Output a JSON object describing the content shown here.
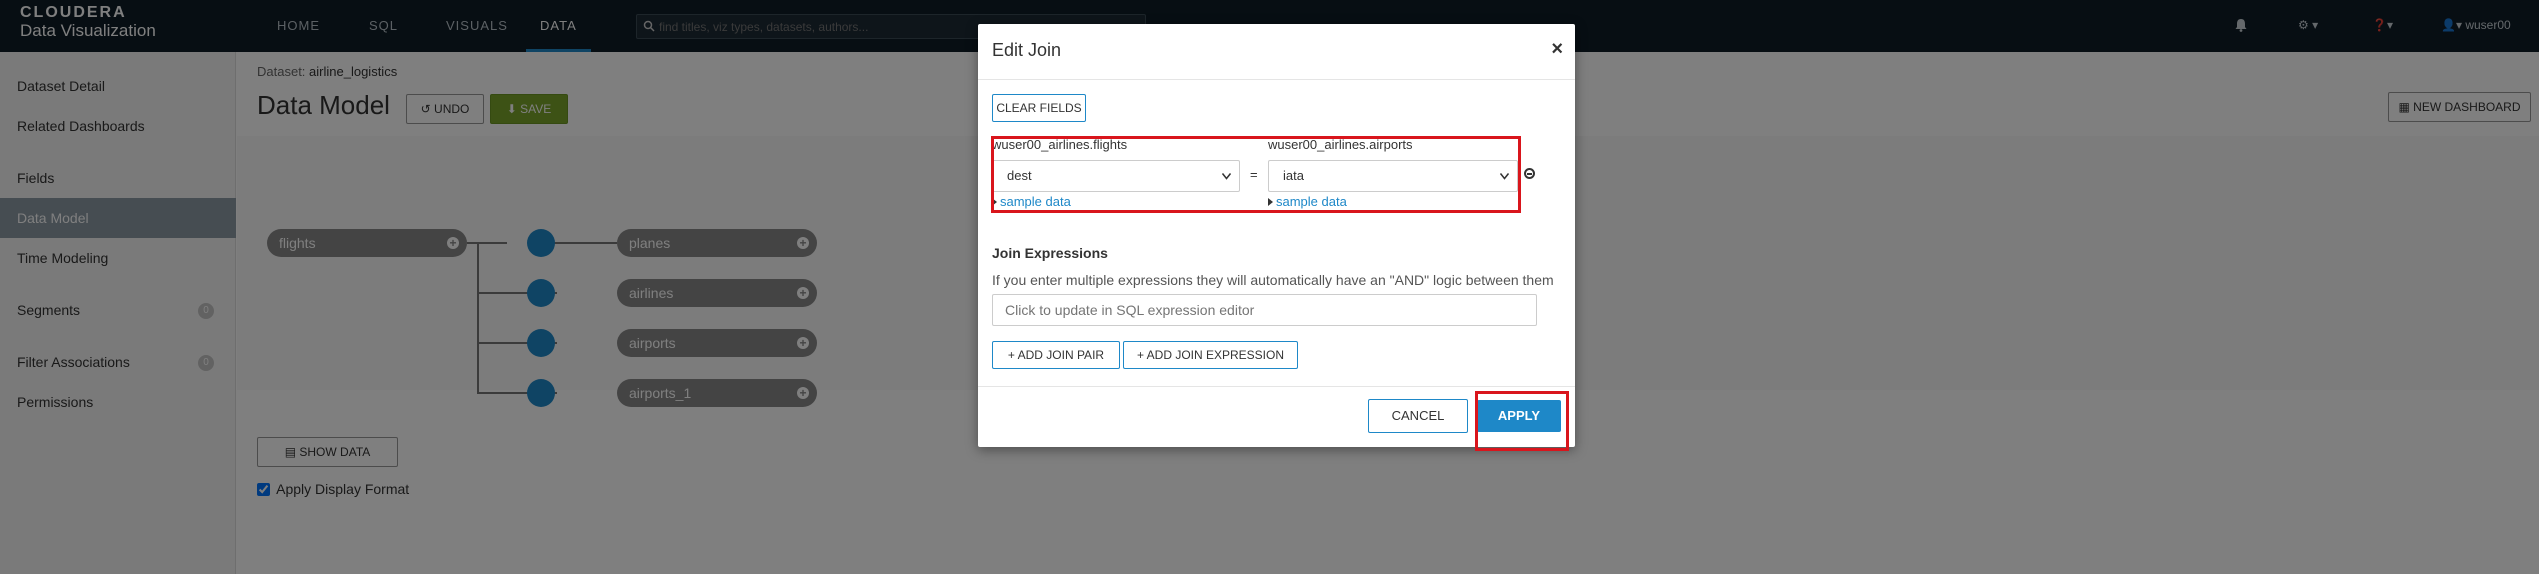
{
  "brand": {
    "line1": "CLOUDERA",
    "line2": "Data Visualization"
  },
  "nav": {
    "tabs": [
      "HOME",
      "SQL",
      "VISUALS",
      "DATA"
    ],
    "active_tab": "DATA",
    "search_placeholder": "find titles, viz types, datasets, authors...",
    "user": "wuser00"
  },
  "sidebar": {
    "items": [
      {
        "label": "Dataset Detail"
      },
      {
        "label": "Related Dashboards"
      },
      {
        "label": "Fields"
      },
      {
        "label": "Data Model",
        "active": true
      },
      {
        "label": "Time Modeling"
      },
      {
        "label": "Segments",
        "badge": "0"
      },
      {
        "label": "Filter Associations",
        "badge": "0"
      },
      {
        "label": "Permissions"
      }
    ]
  },
  "main": {
    "dataset_prefix": "Dataset:",
    "dataset_name": "airline_logistics",
    "title": "Data Model",
    "undo_label": "UNDO",
    "save_label": "SAVE",
    "new_dashboard_label": "NEW DASHBOARD",
    "show_data_label": "SHOW DATA",
    "apply_display_format_label": "Apply Display Format",
    "model": {
      "root": "flights",
      "children": [
        "planes",
        "airlines",
        "airports",
        "airports_1"
      ]
    }
  },
  "modal": {
    "title": "Edit Join",
    "close": "×",
    "clear_fields_label": "CLEAR FIELDS",
    "left_table": "wuser00_airlines.flights",
    "right_table": "wuser00_airlines.airports",
    "left_field": "dest",
    "right_field": "iata",
    "equals": "=",
    "sample_data_label": "sample data",
    "join_expressions_label": "Join Expressions",
    "join_expressions_desc": "If you enter multiple expressions they will automatically have an \"AND\" logic between them",
    "expression_placeholder": "Click to update in SQL expression editor",
    "add_join_pair_label": "ADD JOIN PAIR",
    "add_join_expression_label": "ADD JOIN EXPRESSION",
    "cancel_label": "CANCEL",
    "apply_label": "APPLY"
  },
  "colors": {
    "accent": "#1e88c8",
    "save_green": "#7aa52b",
    "highlight_red": "#d9151c",
    "topnav_bg": "#0f1d27"
  }
}
